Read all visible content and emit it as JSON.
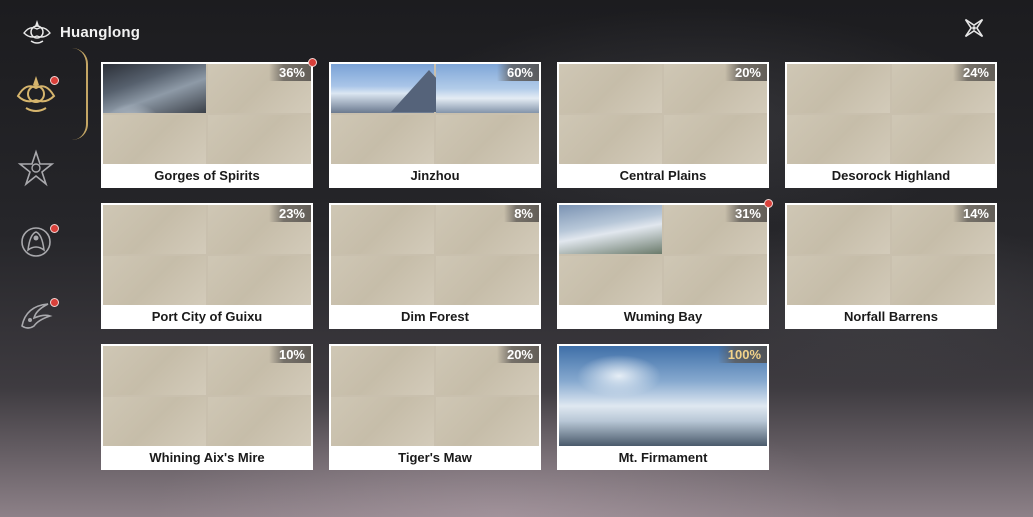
{
  "header": {
    "title": "Huanglong",
    "emblem_icon": "huanglong-emblem-icon",
    "close_icon": "close-x-icon"
  },
  "sidebar": {
    "items": [
      {
        "name": "sidebar-item-regions",
        "icon": "golden-emblem-icon",
        "active": true,
        "notification": true
      },
      {
        "name": "sidebar-item-2",
        "icon": "star-crest-icon",
        "active": false,
        "notification": false
      },
      {
        "name": "sidebar-item-3",
        "icon": "phoenix-crest-icon",
        "active": false,
        "notification": true
      },
      {
        "name": "sidebar-item-4",
        "icon": "wing-crest-icon",
        "active": false,
        "notification": true
      }
    ]
  },
  "accent_colors": {
    "notification": "#d9403a",
    "complete": "#f2d28a",
    "active": "#d6b56d"
  },
  "regions": [
    {
      "name": "Gorges of Spirits",
      "progress": "36%",
      "notification": true
    },
    {
      "name": "Jinzhou",
      "progress": "60%",
      "notification": false
    },
    {
      "name": "Central Plains",
      "progress": "20%",
      "notification": false
    },
    {
      "name": "Desorock Highland",
      "progress": "24%",
      "notification": false
    },
    {
      "name": "Port City of Guixu",
      "progress": "23%",
      "notification": false
    },
    {
      "name": "Dim Forest",
      "progress": "8%",
      "notification": false
    },
    {
      "name": "Wuming Bay",
      "progress": "31%",
      "notification": true
    },
    {
      "name": "Norfall Barrens",
      "progress": "14%",
      "notification": false
    },
    {
      "name": "Whining Aix's Mire",
      "progress": "10%",
      "notification": false
    },
    {
      "name": "Tiger's Maw",
      "progress": "20%",
      "notification": false
    },
    {
      "name": "Mt. Firmament",
      "progress": "100%",
      "notification": false
    }
  ]
}
